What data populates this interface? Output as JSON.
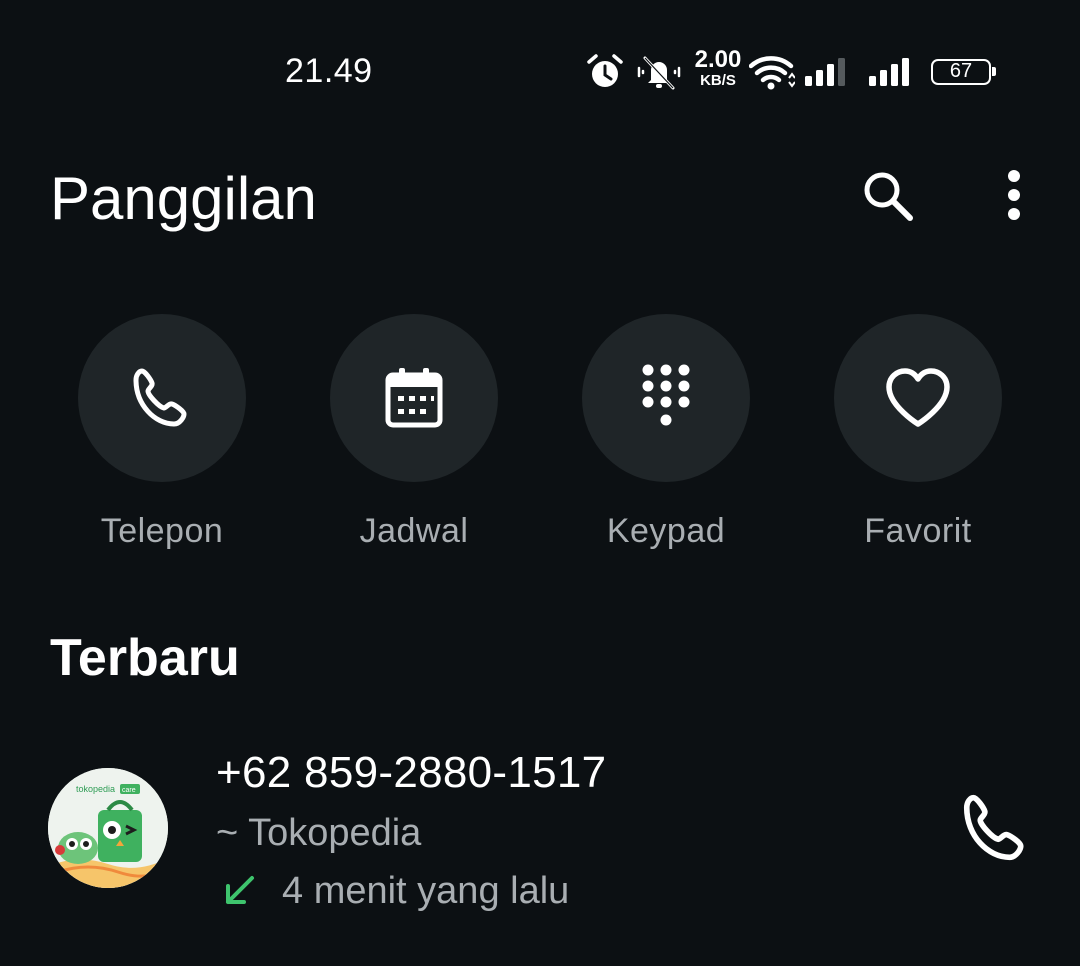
{
  "status_bar": {
    "time": "21.49",
    "net_speed_value": "2.00",
    "net_speed_unit": "KB/S",
    "battery_level": "67",
    "icons": [
      "alarm-icon",
      "mute-icon",
      "wifi-icon",
      "signal-icon",
      "signal-icon",
      "battery-icon"
    ]
  },
  "header": {
    "title": "Panggilan",
    "search_icon": "search-icon",
    "more_icon": "more-vert-icon"
  },
  "quick_actions": [
    {
      "label": "Telepon",
      "icon": "phone-icon"
    },
    {
      "label": "Jadwal",
      "icon": "calendar-icon"
    },
    {
      "label": "Keypad",
      "icon": "dialpad-icon"
    },
    {
      "label": "Favorit",
      "icon": "heart-icon"
    }
  ],
  "recent": {
    "title": "Terbaru",
    "calls": [
      {
        "number": "+62 859-2880-1517",
        "name": "~ Tokopedia",
        "time": "4 menit yang lalu",
        "direction": "incoming",
        "direction_color": "#3ec46d",
        "avatar_label": "tokopedia care",
        "action_icon": "phone-icon"
      }
    ]
  }
}
